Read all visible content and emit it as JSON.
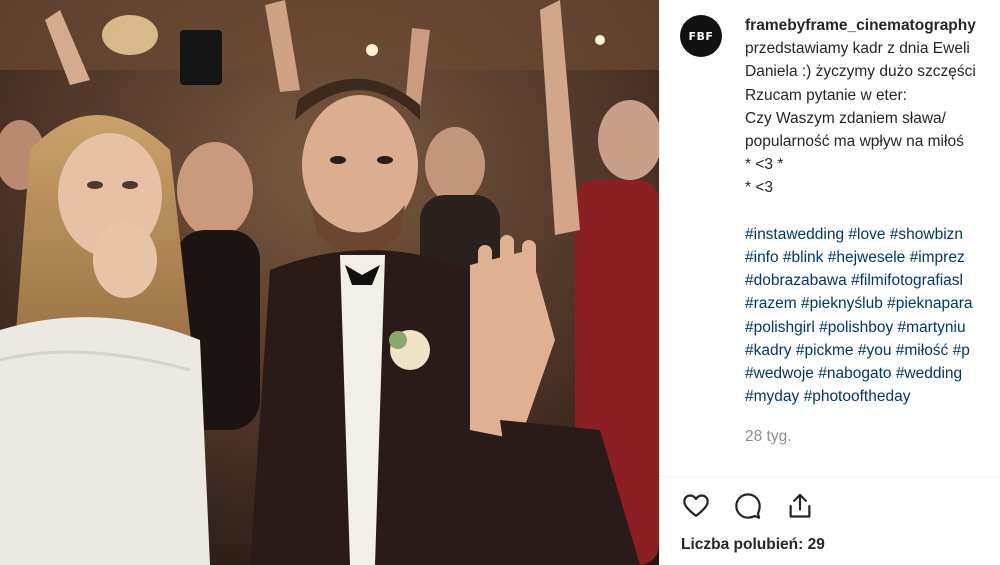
{
  "post": {
    "avatar_text": "FBF",
    "username": "framebyframe_cinematography",
    "caption_lines": [
      "przedstawiamy kadr z dnia Eweli",
      "Daniela :) życzymy dużo szczęści",
      "Rzucam pytanie w eter:",
      "Czy Waszym zdaniem sława/",
      "popularność ma wpływ na miłoś",
      "* <3 *",
      "* <3"
    ],
    "hashtag_lines": [
      "#instawedding #love #showbizn",
      "#info #blink #hejwesele #imprez",
      "#dobrazabawa #filmifotografiasl",
      "#razem #pieknyślub #pieknapara",
      "#polishgirl #polishboy #martyniu",
      "#kadry #pickme #you #miłość #p",
      "#wedwoje #nabogato #wedding",
      "#myday #photooftheday"
    ],
    "time_ago": "28 tyg.",
    "likes_text": "Liczba polubień: 29"
  },
  "icons": {
    "like": "heart-icon",
    "comment": "comment-icon",
    "share": "share-icon"
  },
  "colors": {
    "hashtag": "#00376b",
    "muted": "#8e8e8e",
    "text": "#262626"
  }
}
